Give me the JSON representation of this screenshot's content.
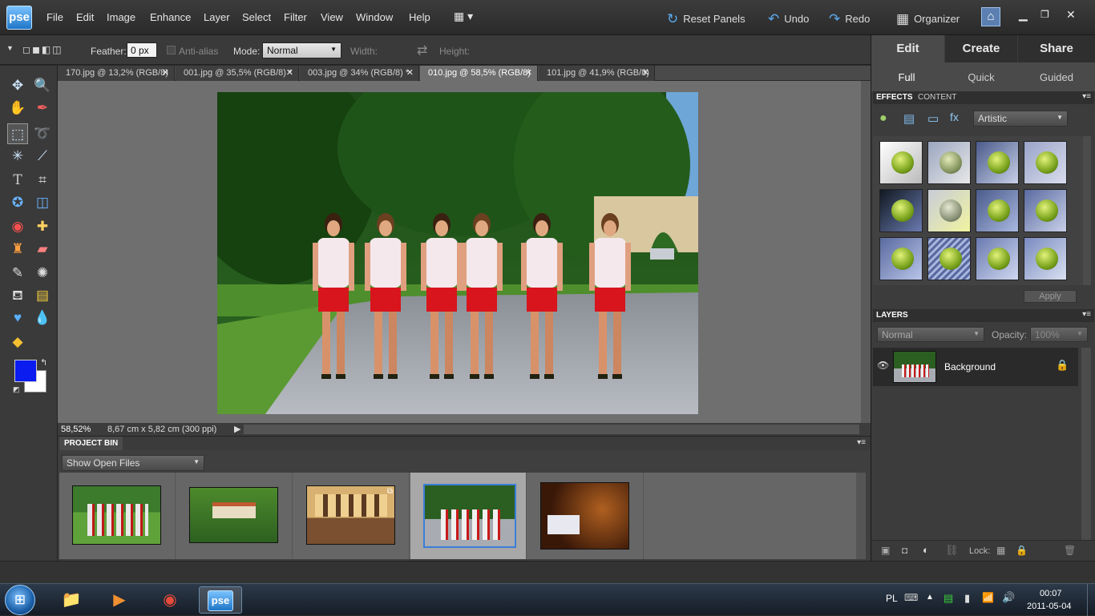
{
  "app": {
    "logo": "pse"
  },
  "menu": {
    "items": [
      "File",
      "Edit",
      "Image",
      "Enhance",
      "Layer",
      "Select",
      "Filter",
      "View",
      "Window",
      "Help"
    ]
  },
  "top_actions": {
    "reset_panels": "Reset Panels",
    "undo": "Undo",
    "redo": "Redo",
    "organizer": "Organizer"
  },
  "options": {
    "feather_label": "Feather:",
    "feather_value": "0 px",
    "anti_alias": "Anti-alias",
    "mode_label": "Mode:",
    "mode_value": "Normal",
    "width_label": "Width:",
    "height_label": "Height:"
  },
  "tabs": [
    {
      "label": "170.jpg @ 13,2% (RGB/8)"
    },
    {
      "label": "001.jpg @ 35,5% (RGB/8) *"
    },
    {
      "label": "003.jpg @ 34% (RGB/8) *"
    },
    {
      "label": "010.jpg @ 58,5% (RGB/8)"
    },
    {
      "label": "101.jpg @ 41,9% (RGB/8)"
    }
  ],
  "status": {
    "zoom": "58,52%",
    "info": "8,67 cm x 5,82 cm (300 ppi)"
  },
  "bin": {
    "title": "PROJECT BIN",
    "filter": "Show Open Files"
  },
  "right_panel": {
    "modes": [
      "Edit",
      "Create",
      "Share"
    ],
    "submodes": [
      "Full",
      "Quick",
      "Guided"
    ],
    "effects_tab": "EFFECTS",
    "content_tab": "CONTENT",
    "effects_category": "Artistic",
    "apply": "Apply",
    "layers_title": "LAYERS",
    "blend_mode": "Normal",
    "opacity_label": "Opacity:",
    "opacity_value": "100%",
    "layer_name": "Background",
    "lock_label": "Lock:"
  },
  "taskbar": {
    "lang": "PL",
    "time": "00:07",
    "date": "2011-05-04"
  },
  "colors": {
    "foreground": "#0a1cf0",
    "background": "#ffffff",
    "accent": "#5aaaf0"
  }
}
